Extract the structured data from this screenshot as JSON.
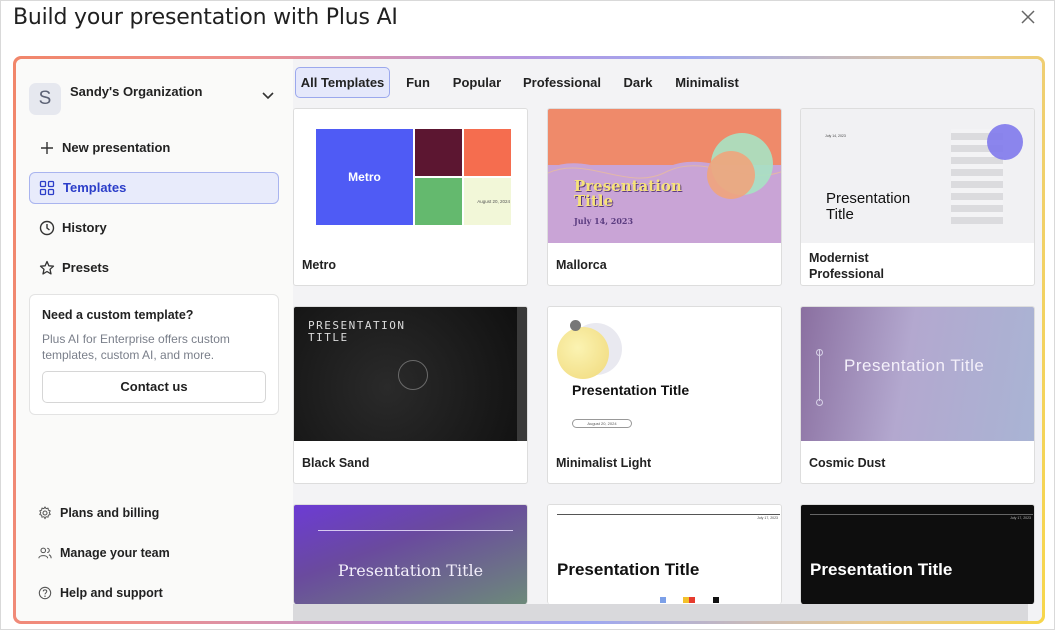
{
  "window": {
    "title": "Build your presentation with Plus AI"
  },
  "sidebar": {
    "org": {
      "initial": "S",
      "name": "Sandy's Organization"
    },
    "nav": [
      {
        "label": "New presentation",
        "icon": "plus-icon",
        "active": false
      },
      {
        "label": "Templates",
        "icon": "grid-icon",
        "active": true
      },
      {
        "label": "History",
        "icon": "clock-icon",
        "active": false
      },
      {
        "label": "Presets",
        "icon": "star-icon",
        "active": false
      }
    ],
    "custom": {
      "heading": "Need a custom template?",
      "text": "Plus AI for Enterprise offers custom templates, custom AI, and more.",
      "button": "Contact us"
    },
    "bottom": [
      {
        "label": "Plans and billing",
        "icon": "gear-icon"
      },
      {
        "label": "Manage your team",
        "icon": "team-icon"
      },
      {
        "label": "Help and support",
        "icon": "help-icon"
      }
    ]
  },
  "tabs": [
    "All Templates",
    "Fun",
    "Popular",
    "Professional",
    "Dark",
    "Minimalist"
  ],
  "active_tab": "All Templates",
  "templates": [
    {
      "name": "Metro",
      "thumb": {
        "title": "Metro",
        "date": "August 20, 2024"
      }
    },
    {
      "name": "Mallorca",
      "thumb": {
        "title": "Presentation Title",
        "date": "July 14, 2023"
      }
    },
    {
      "name": "Modernist Professional",
      "thumb": {
        "title": "Presentation Title",
        "date": "July 14, 2023"
      }
    },
    {
      "name": "Black Sand",
      "thumb": {
        "title": "PRESENTATION TITLE"
      }
    },
    {
      "name": "Minimalist Light",
      "thumb": {
        "title": "Presentation Title",
        "date": "August 20, 2024"
      }
    },
    {
      "name": "Cosmic Dust",
      "thumb": {
        "title": "Presentation Title"
      }
    },
    {
      "name": "",
      "thumb": {
        "title": "Presentation Title"
      }
    },
    {
      "name": "",
      "thumb": {
        "title": "Presentation Title",
        "date": "July 17, 2023"
      }
    },
    {
      "name": "",
      "thumb": {
        "title": "Presentation Title",
        "date": "July 17, 2023"
      }
    }
  ],
  "colors": {
    "accent": "#2c3ec9",
    "active_bg": "#e8ebfb",
    "metro_blue": "#4f5bf5"
  }
}
